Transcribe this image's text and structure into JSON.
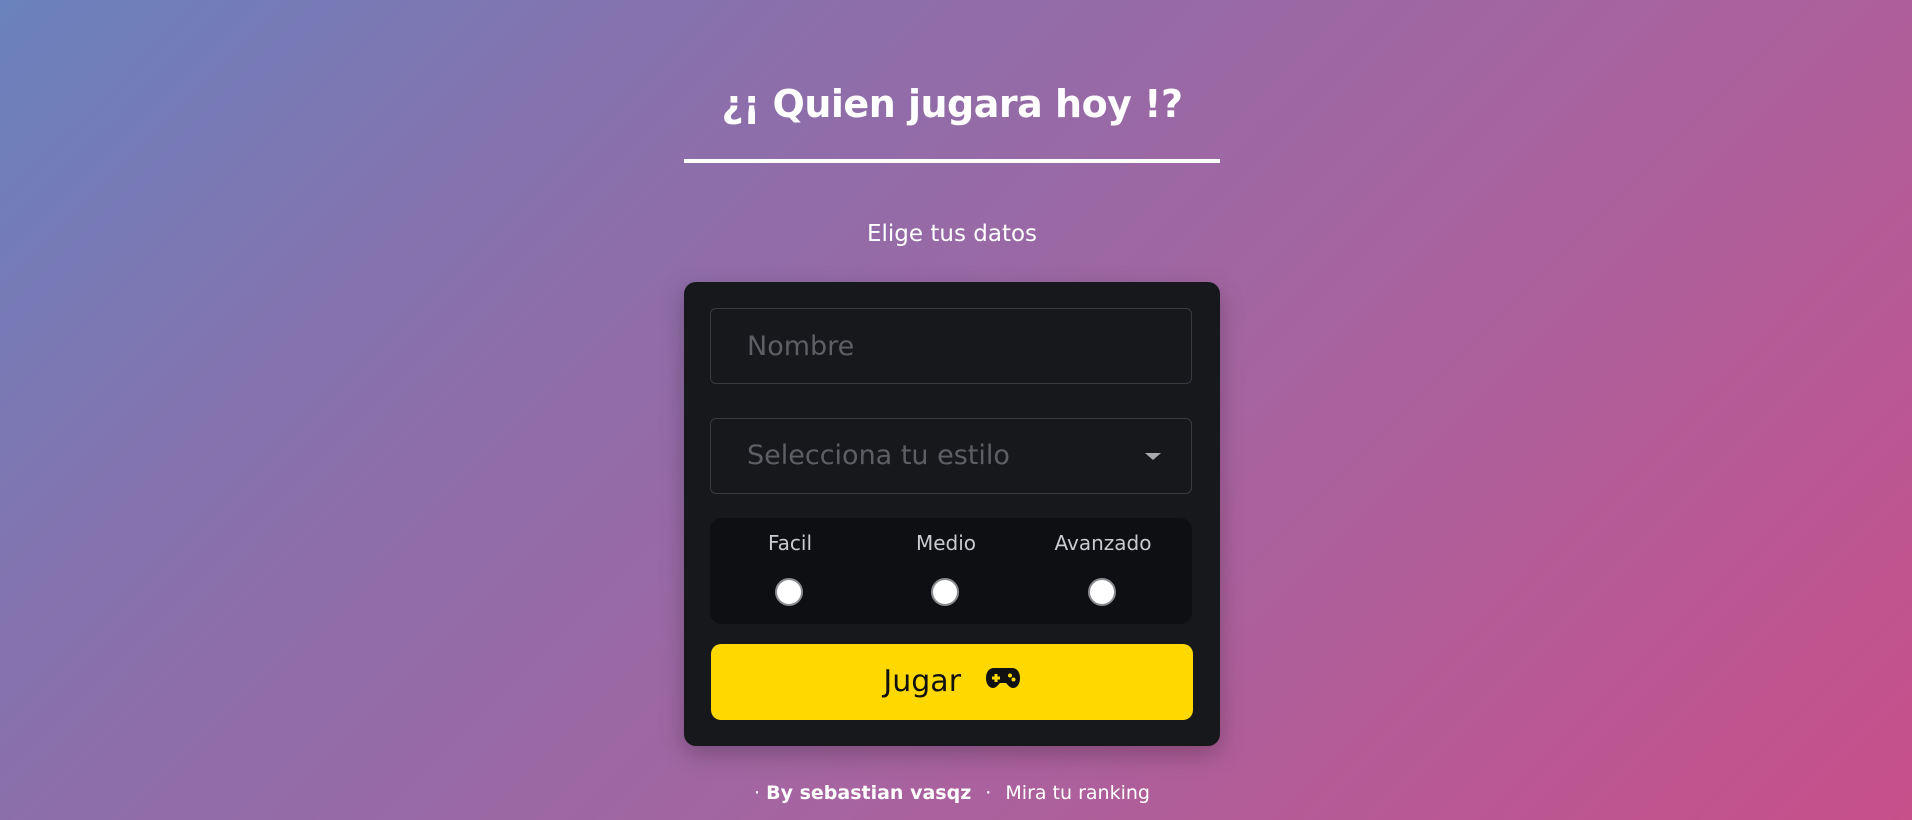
{
  "header": {
    "title": "¿¡ Quien jugara hoy !?",
    "subtitle": "Elige tus datos"
  },
  "form": {
    "name_placeholder": "Nombre",
    "style_select_placeholder": "Selecciona tu estilo",
    "difficulty_options": [
      "Facil",
      "Medio",
      "Avanzado"
    ],
    "play_button_label": "Jugar",
    "play_button_icon": "gamepad-icon"
  },
  "footer": {
    "prefix": "·",
    "author": "By sebastian vasqz",
    "separator": "·",
    "ranking_link": "Mira tu ranking"
  },
  "colors": {
    "background_gradient": [
      "#6a82bd",
      "#c74f8a"
    ],
    "card": "#17181c",
    "accent": "#ffd800",
    "text": "#ffffff"
  }
}
